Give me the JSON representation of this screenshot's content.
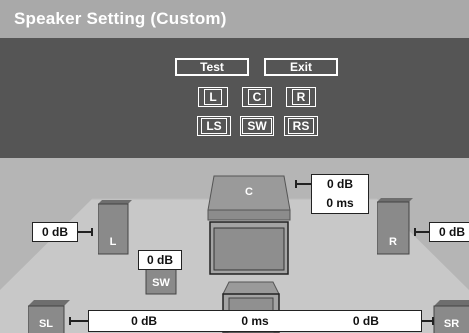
{
  "window": {
    "title": "Speaker Setting (Custom)"
  },
  "controls": {
    "test_label": "Test",
    "exit_label": "Exit",
    "channels": [
      "L",
      "C",
      "R",
      "LS",
      "SW",
      "RS"
    ]
  },
  "speakers": {
    "left": "L",
    "center": "C",
    "right": "R",
    "subwoofer": "SW",
    "surround_left": "SL",
    "surround_right": "SR"
  },
  "readouts": {
    "left_level": "0 dB",
    "center_level": "0 dB",
    "center_delay": "0 ms",
    "right_level": "0 dB",
    "subwoofer_level": "0 dB",
    "surround_level_left": "0 dB",
    "surround_delay": "0 ms",
    "surround_level_right": "0 dB"
  },
  "colors": {
    "header": "#a9a9a9",
    "panel": "#555555",
    "floor": "#c8c8c8",
    "speaker": "#8a8a8a"
  }
}
